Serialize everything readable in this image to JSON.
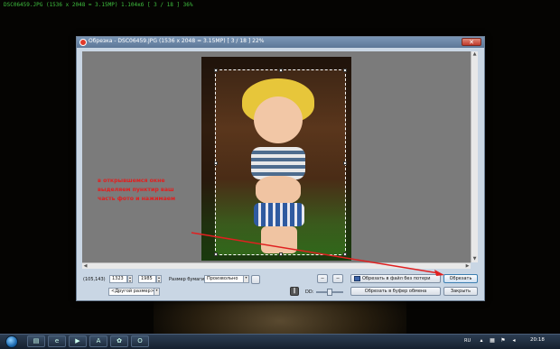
{
  "viewer": {
    "info": "DSC06459.JPG  (1536 x 2048 = 3.15MP)  1.104кб  [ 3 / 18 ]  36%"
  },
  "dialog": {
    "title": "Обрезка - DSC06459.JPG  (1536 x 2048 = 3.15MP)  [ 3 / 18 ]  22%",
    "close_label": "✕"
  },
  "annotation": {
    "text": "в открывшемся окне\nвыделяем пунктир ваш\nчасть фото и нажимаем"
  },
  "controls": {
    "position": "(105,143)",
    "width": "1323",
    "height": "1985",
    "paper_size_label": "Размер бумаги:",
    "paper_size_value": "Произвольно",
    "ratio_value": "<Другой размер>",
    "dd_label": "DD:",
    "save_lossless_label": "Обрезать в файл без потери",
    "crop_label": "Обрезать",
    "crop_clipboard_label": "Обрезать в буфер обмена",
    "close_label": "Закрыть"
  },
  "icons": {
    "dialog_icon": "red-dot-icon",
    "close": "close-icon",
    "prev": "left-arrow-icon",
    "next": "right-arrow-icon",
    "save": "floppy-icon",
    "spin_up": "triangle-up-icon",
    "spin_down": "triangle-down-icon",
    "dropdown": "chevron-down-icon"
  },
  "taskbar": {
    "language": "RU",
    "clock": "20:18",
    "apps": [
      "explorer-icon",
      "ie-icon",
      "media-player-icon",
      "adobe-icon",
      "irfanview-icon",
      "opera-icon"
    ]
  }
}
